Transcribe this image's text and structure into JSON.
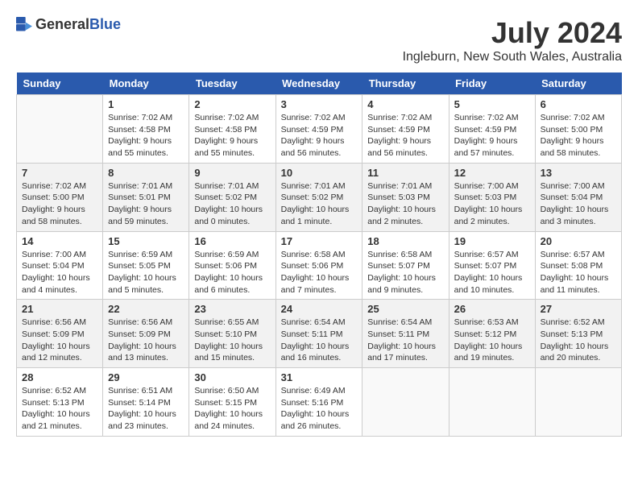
{
  "header": {
    "logo_general": "General",
    "logo_blue": "Blue",
    "month": "July 2024",
    "location": "Ingleburn, New South Wales, Australia"
  },
  "days_of_week": [
    "Sunday",
    "Monday",
    "Tuesday",
    "Wednesday",
    "Thursday",
    "Friday",
    "Saturday"
  ],
  "weeks": [
    [
      {
        "date": "",
        "empty": true
      },
      {
        "date": "1",
        "sunrise": "7:02 AM",
        "sunset": "4:58 PM",
        "daylight": "9 hours and 55 minutes."
      },
      {
        "date": "2",
        "sunrise": "7:02 AM",
        "sunset": "4:58 PM",
        "daylight": "9 hours and 55 minutes."
      },
      {
        "date": "3",
        "sunrise": "7:02 AM",
        "sunset": "4:59 PM",
        "daylight": "9 hours and 56 minutes."
      },
      {
        "date": "4",
        "sunrise": "7:02 AM",
        "sunset": "4:59 PM",
        "daylight": "9 hours and 56 minutes."
      },
      {
        "date": "5",
        "sunrise": "7:02 AM",
        "sunset": "4:59 PM",
        "daylight": "9 hours and 57 minutes."
      },
      {
        "date": "6",
        "sunrise": "7:02 AM",
        "sunset": "5:00 PM",
        "daylight": "9 hours and 58 minutes."
      }
    ],
    [
      {
        "date": "7",
        "sunrise": "7:02 AM",
        "sunset": "5:00 PM",
        "daylight": "9 hours and 58 minutes."
      },
      {
        "date": "8",
        "sunrise": "7:01 AM",
        "sunset": "5:01 PM",
        "daylight": "9 hours and 59 minutes."
      },
      {
        "date": "9",
        "sunrise": "7:01 AM",
        "sunset": "5:02 PM",
        "daylight": "10 hours and 0 minutes."
      },
      {
        "date": "10",
        "sunrise": "7:01 AM",
        "sunset": "5:02 PM",
        "daylight": "10 hours and 1 minute."
      },
      {
        "date": "11",
        "sunrise": "7:01 AM",
        "sunset": "5:03 PM",
        "daylight": "10 hours and 2 minutes."
      },
      {
        "date": "12",
        "sunrise": "7:00 AM",
        "sunset": "5:03 PM",
        "daylight": "10 hours and 2 minutes."
      },
      {
        "date": "13",
        "sunrise": "7:00 AM",
        "sunset": "5:04 PM",
        "daylight": "10 hours and 3 minutes."
      }
    ],
    [
      {
        "date": "14",
        "sunrise": "7:00 AM",
        "sunset": "5:04 PM",
        "daylight": "10 hours and 4 minutes."
      },
      {
        "date": "15",
        "sunrise": "6:59 AM",
        "sunset": "5:05 PM",
        "daylight": "10 hours and 5 minutes."
      },
      {
        "date": "16",
        "sunrise": "6:59 AM",
        "sunset": "5:06 PM",
        "daylight": "10 hours and 6 minutes."
      },
      {
        "date": "17",
        "sunrise": "6:58 AM",
        "sunset": "5:06 PM",
        "daylight": "10 hours and 7 minutes."
      },
      {
        "date": "18",
        "sunrise": "6:58 AM",
        "sunset": "5:07 PM",
        "daylight": "10 hours and 9 minutes."
      },
      {
        "date": "19",
        "sunrise": "6:57 AM",
        "sunset": "5:07 PM",
        "daylight": "10 hours and 10 minutes."
      },
      {
        "date": "20",
        "sunrise": "6:57 AM",
        "sunset": "5:08 PM",
        "daylight": "10 hours and 11 minutes."
      }
    ],
    [
      {
        "date": "21",
        "sunrise": "6:56 AM",
        "sunset": "5:09 PM",
        "daylight": "10 hours and 12 minutes."
      },
      {
        "date": "22",
        "sunrise": "6:56 AM",
        "sunset": "5:09 PM",
        "daylight": "10 hours and 13 minutes."
      },
      {
        "date": "23",
        "sunrise": "6:55 AM",
        "sunset": "5:10 PM",
        "daylight": "10 hours and 15 minutes."
      },
      {
        "date": "24",
        "sunrise": "6:54 AM",
        "sunset": "5:11 PM",
        "daylight": "10 hours and 16 minutes."
      },
      {
        "date": "25",
        "sunrise": "6:54 AM",
        "sunset": "5:11 PM",
        "daylight": "10 hours and 17 minutes."
      },
      {
        "date": "26",
        "sunrise": "6:53 AM",
        "sunset": "5:12 PM",
        "daylight": "10 hours and 19 minutes."
      },
      {
        "date": "27",
        "sunrise": "6:52 AM",
        "sunset": "5:13 PM",
        "daylight": "10 hours and 20 minutes."
      }
    ],
    [
      {
        "date": "28",
        "sunrise": "6:52 AM",
        "sunset": "5:13 PM",
        "daylight": "10 hours and 21 minutes."
      },
      {
        "date": "29",
        "sunrise": "6:51 AM",
        "sunset": "5:14 PM",
        "daylight": "10 hours and 23 minutes."
      },
      {
        "date": "30",
        "sunrise": "6:50 AM",
        "sunset": "5:15 PM",
        "daylight": "10 hours and 24 minutes."
      },
      {
        "date": "31",
        "sunrise": "6:49 AM",
        "sunset": "5:16 PM",
        "daylight": "10 hours and 26 minutes."
      },
      {
        "date": "",
        "empty": true
      },
      {
        "date": "",
        "empty": true
      },
      {
        "date": "",
        "empty": true
      }
    ]
  ]
}
